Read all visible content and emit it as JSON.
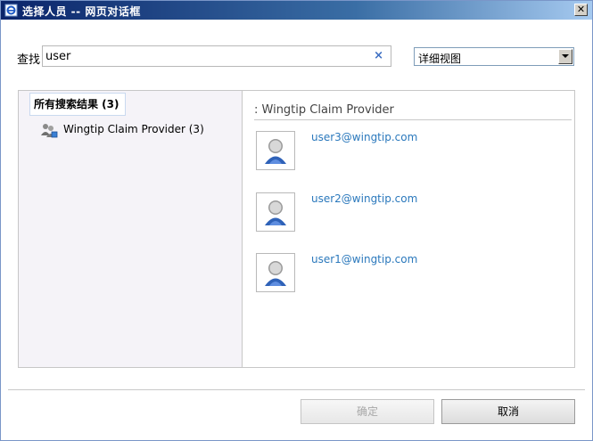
{
  "window": {
    "title": "选择人员 -- 网页对话框",
    "close_glyph": "✕"
  },
  "search": {
    "label": "查找",
    "value": "user",
    "clear_glyph": "×"
  },
  "view_select": {
    "selected": "详细视图"
  },
  "tree": {
    "root_label": "所有搜索结果 (3)",
    "children": [
      {
        "label": "Wingtip Claim Provider (3)"
      }
    ]
  },
  "results": {
    "group_header": ": Wingtip Claim Provider",
    "items": [
      {
        "name": "user3@wingtip.com"
      },
      {
        "name": "user2@wingtip.com"
      },
      {
        "name": "user1@wingtip.com"
      }
    ]
  },
  "buttons": {
    "ok_label": "确定",
    "cancel_label": "取消"
  },
  "colors": {
    "link": "#2a78bc",
    "title_bar": "#0a246a",
    "left_pane_bg": "#f5f3f8"
  }
}
